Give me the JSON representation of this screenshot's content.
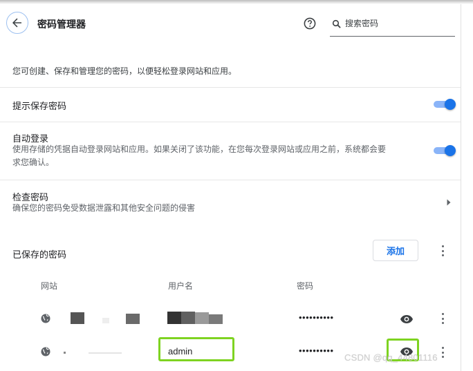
{
  "header": {
    "title": "密码管理器",
    "search_placeholder": "搜索密码"
  },
  "intro": "您可创建、保存和管理您的密码，以便轻松登录网站和应用。",
  "settings": {
    "offer_to_save": {
      "label": "提示保存密码",
      "enabled": true
    },
    "auto_sign_in": {
      "label": "自动登录",
      "desc_line1": "使用存储的凭据自动登录网站和应用。如果关闭了该功能，在您每次登录网站或应用之前，系统都会要",
      "desc_line2": "求您确认。",
      "enabled": true
    },
    "check_passwords": {
      "label": "检查密码",
      "desc": "确保您的密码免受数据泄露和其他安全问题的侵害"
    }
  },
  "saved": {
    "title": "已保存的密码",
    "add_label": "添加",
    "columns": [
      "网站",
      "用户名",
      "密码"
    ],
    "rows": [
      {
        "site": "",
        "username": "",
        "password": "••••••••••"
      },
      {
        "site": "",
        "username": "admin",
        "password": "••••••••••"
      }
    ]
  },
  "colors": {
    "accent": "#1a73e8",
    "toggle_track": "#8ab4f8",
    "highlight": "#7ed321"
  },
  "watermark": "CSDN @qq_44801116"
}
